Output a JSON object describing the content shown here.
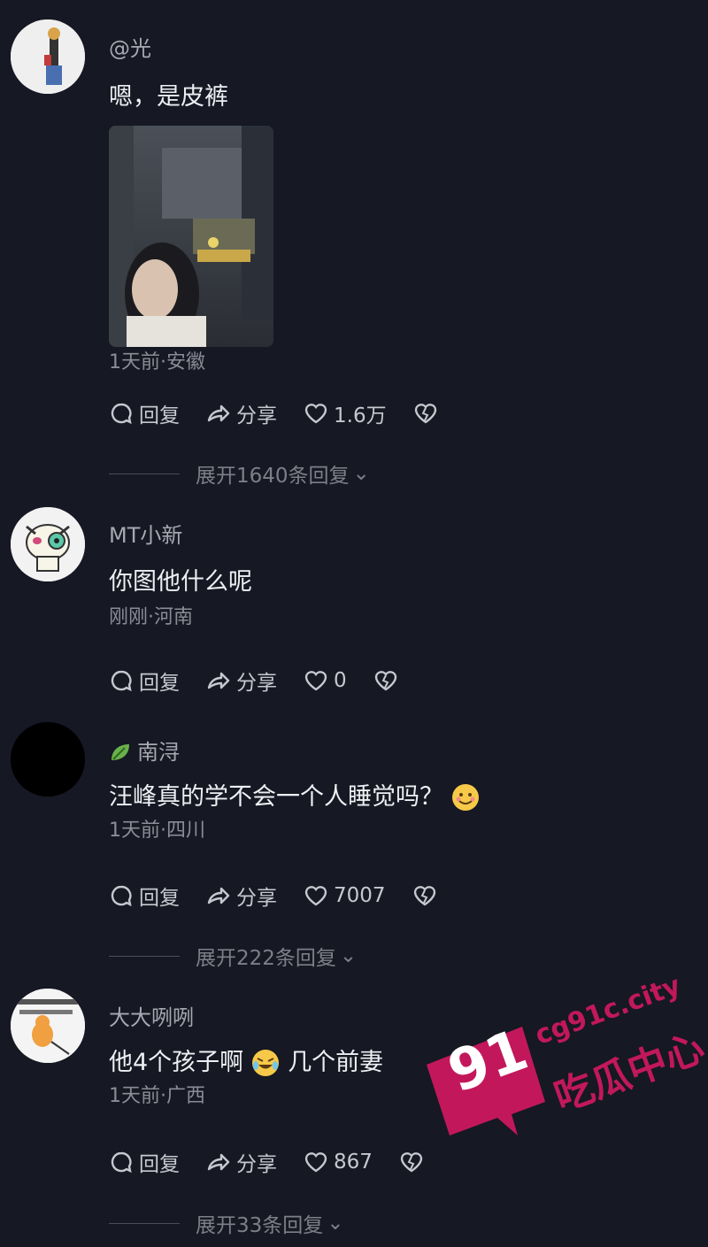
{
  "comments": [
    {
      "username": "@光",
      "text": "嗯，是皮裤",
      "meta": "1天前·安徽",
      "reply_label": "回复",
      "share_label": "分享",
      "likes": "1.6万",
      "expand_label": "展开1640条回复"
    },
    {
      "username": "MT小新",
      "text": "你图他什么呢",
      "meta": "刚刚·河南",
      "reply_label": "回复",
      "share_label": "分享",
      "likes": "0"
    },
    {
      "username": "南浔",
      "text": "汪峰真的学不会一个人睡觉吗？",
      "meta": "1天前·四川",
      "reply_label": "回复",
      "share_label": "分享",
      "likes": "7007",
      "expand_label": "展开222条回复"
    },
    {
      "username": "大大咧咧",
      "text_before": "他4个孩子啊",
      "text_after": "几个前妻",
      "meta": "1天前·广西",
      "reply_label": "回复",
      "share_label": "分享",
      "likes": "867",
      "expand_label": "展开33条回复"
    }
  ],
  "watermark": {
    "number": "91",
    "url": "cg91c.city",
    "name": "吃瓜中心",
    "color": "#c2185b"
  }
}
